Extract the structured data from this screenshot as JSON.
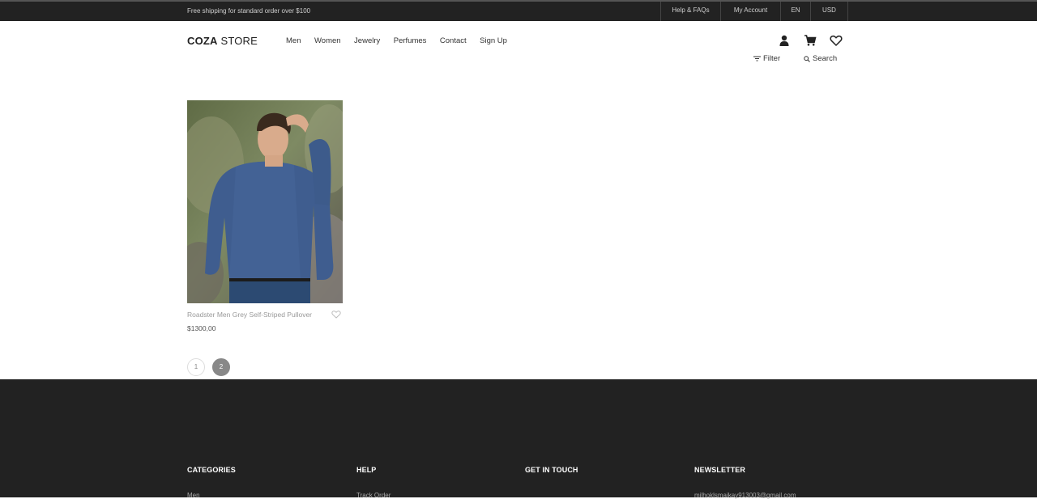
{
  "topbar": {
    "shipping": "Free shipping for standard order over $100",
    "links": [
      "Help & FAQs",
      "My Account",
      "EN",
      "USD"
    ]
  },
  "header": {
    "logo_bold": "COZA",
    "logo_rest": " STORE",
    "nav": [
      "Men",
      "Women",
      "Jewelry",
      "Perfumes",
      "Contact",
      "Sign Up"
    ],
    "icons": [
      "user-icon",
      "cart-icon",
      "heart-icon"
    ],
    "filter_label": "Filter",
    "search_label": "Search"
  },
  "product": {
    "name": "Roadster Men Grey Self-Striped Pullover",
    "price": "$1300,00",
    "image": "man-blue-sweater-photo"
  },
  "pagination": {
    "pages": [
      "1",
      "2"
    ],
    "active": "2"
  },
  "footer": {
    "columns": [
      {
        "title": "CATEGORIES",
        "first": "Men"
      },
      {
        "title": "HELP",
        "first": "Track Order"
      },
      {
        "title": "GET IN TOUCH",
        "first": ""
      },
      {
        "title": "NEWSLETTER",
        "first": "milhoklsmaikay913003@gmail.com"
      }
    ]
  },
  "colors": {
    "dark": "#222222",
    "accent": "#888888",
    "text": "#333333"
  }
}
